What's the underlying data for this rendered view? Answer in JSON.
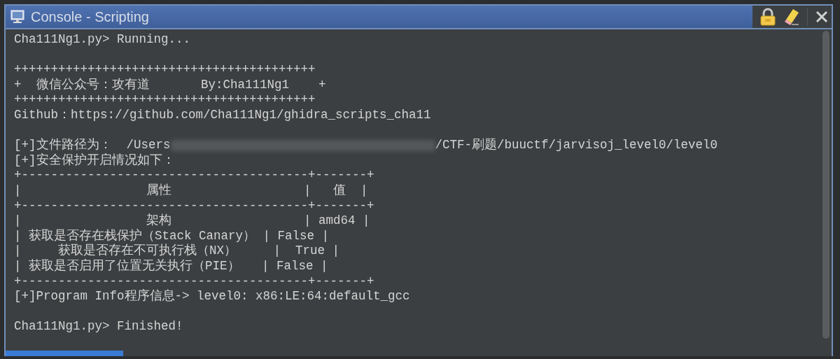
{
  "window": {
    "title": "Console - Scripting"
  },
  "console": {
    "lines": [
      {
        "kind": "text",
        "text": "Cha111Ng1.py> Running..."
      },
      {
        "kind": "blank"
      },
      {
        "kind": "text",
        "text": "+++++++++++++++++++++++++++++++++++++++++"
      },
      {
        "kind": "text",
        "text": "+  微信公众号：攻有道       By:Cha111Ng1    +"
      },
      {
        "kind": "text",
        "text": "+++++++++++++++++++++++++++++++++++++++++"
      },
      {
        "kind": "text",
        "text": "Github：https://github.com/Cha111Ng1/ghidra_scripts_cha11"
      },
      {
        "kind": "blank"
      },
      {
        "kind": "redacted",
        "before": "[+]文件路径为：  /Users",
        "after": "/CTF-刷题/buuctf/jarvisoj_level0/level0"
      },
      {
        "kind": "text",
        "text": "[+]安全保护开启情况如下："
      },
      {
        "kind": "text",
        "text": "+---------------------------------------+-------+"
      },
      {
        "kind": "text",
        "text": "|                 属性                  |   值  |"
      },
      {
        "kind": "text",
        "text": "+---------------------------------------+-------+"
      },
      {
        "kind": "text",
        "text": "|                 架构                  | amd64 |"
      },
      {
        "kind": "text",
        "text": "| 获取是否存在栈保护（Stack Canary） | False |"
      },
      {
        "kind": "text",
        "text": "|     获取是否存在不可执行栈（NX）     |  True |"
      },
      {
        "kind": "text",
        "text": "| 获取是否启用了位置无关执行（PIE）   | False |"
      },
      {
        "kind": "text",
        "text": "+---------------------------------------+-------+"
      },
      {
        "kind": "text",
        "text": "[+]Program Info程序信息-> level0: x86:LE:64:default_gcc"
      },
      {
        "kind": "blank"
      },
      {
        "kind": "text",
        "text": "Cha111Ng1.py> Finished!"
      }
    ]
  }
}
